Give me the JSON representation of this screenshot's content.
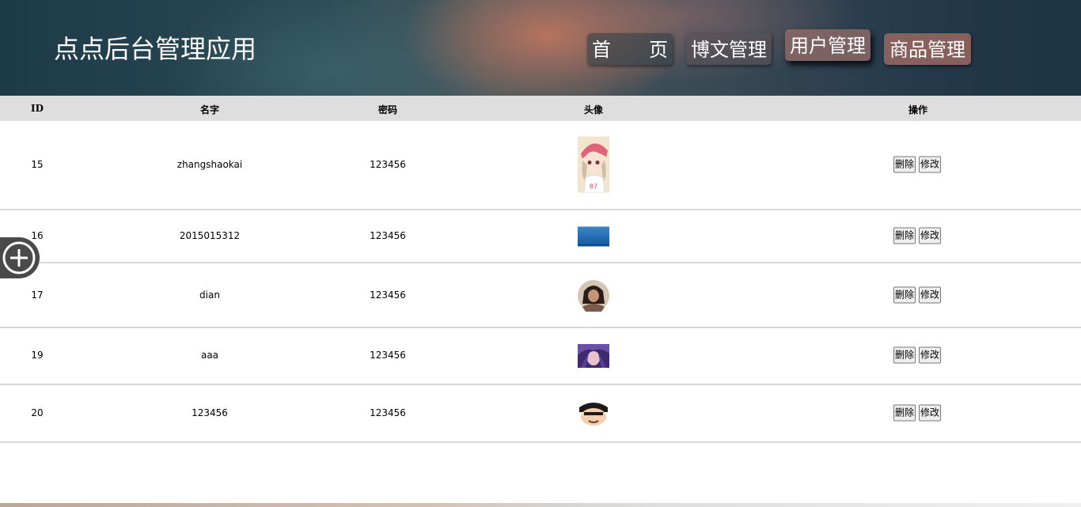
{
  "header": {
    "app_title": "点点后台管理应用",
    "nav": [
      {
        "label": "首 页"
      },
      {
        "label": "博文管理"
      },
      {
        "label": "用户管理"
      },
      {
        "label": "商品管理"
      }
    ]
  },
  "table": {
    "columns": [
      "ID",
      "名字",
      "密码",
      "头像",
      "操作"
    ],
    "rows": [
      {
        "id": "15",
        "name": "zhangshaokai",
        "password": "123456",
        "avatar": "cartoon-girl-avatar",
        "delete": "删除",
        "edit": "修改"
      },
      {
        "id": "16",
        "name": "2015015312",
        "password": "123456",
        "avatar": "blue-banner-avatar",
        "delete": "删除",
        "edit": "修改"
      },
      {
        "id": "17",
        "name": "dian",
        "password": "123456",
        "avatar": "round-photo-avatar",
        "delete": "删除",
        "edit": "修改"
      },
      {
        "id": "19",
        "name": "aaa",
        "password": "123456",
        "avatar": "anime-purple-avatar",
        "delete": "删除",
        "edit": "修改"
      },
      {
        "id": "20",
        "name": "123456",
        "password": "123456",
        "avatar": "cartoon-face-avatar",
        "delete": "删除",
        "edit": "修改"
      }
    ]
  },
  "side_button": {
    "icon": "plus-circle-icon"
  }
}
